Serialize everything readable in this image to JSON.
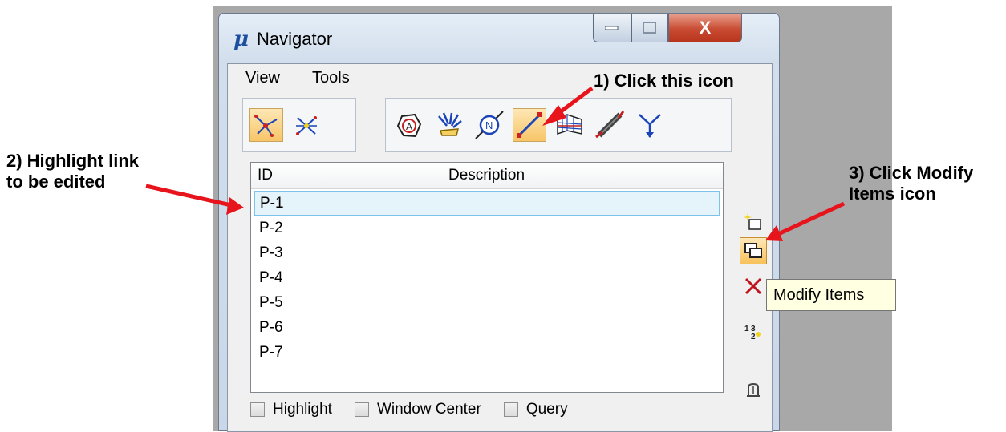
{
  "window": {
    "title": "Navigator",
    "close_glyph": "X"
  },
  "menu": [
    "View",
    "Tools"
  ],
  "list": {
    "columns": [
      "ID",
      "Description"
    ],
    "rows": [
      "P-1",
      "P-2",
      "P-3",
      "P-4",
      "P-5",
      "P-6",
      "P-7"
    ],
    "selected": "P-1"
  },
  "checkboxes": [
    "Highlight",
    "Window Center",
    "Query"
  ],
  "tooltip": "Modify Items",
  "annotations": {
    "step1": "1) Click this icon",
    "step2_line1": "2) Highlight link",
    "step2_line2": "to be edited",
    "step3_line1": "3) Click Modify",
    "step3_line2": "Items icon"
  },
  "icons": {
    "app": "microstation-icon",
    "toolbar_left": [
      "network-view-icon",
      "network-view-alt-icon"
    ],
    "toolbar_right": [
      "area-icon",
      "point-source-icon",
      "node-icon",
      "link-icon",
      "channel-icon",
      "pipe-icon",
      "junction-icon"
    ],
    "side": [
      "add-item-icon",
      "modify-items-icon",
      "delete-icon",
      "renumber-icon",
      "query-icon"
    ]
  },
  "colors": {
    "selection": "#f8c568",
    "arrow": "#e8141c",
    "delete": "#c0141c",
    "tooltip_bg": "#ffffe1"
  }
}
